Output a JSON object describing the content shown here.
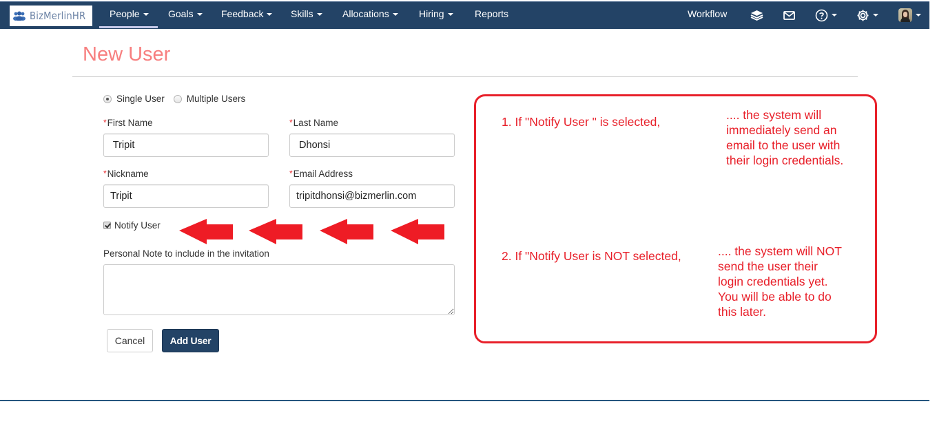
{
  "app": {
    "logo_text": "BizMerlinHR",
    "accent_color": "#234366",
    "title_color": "#f77f7f",
    "annotation_color": "#e8202a"
  },
  "navbar": {
    "items": [
      {
        "label": "People",
        "has_dropdown": true,
        "active": true
      },
      {
        "label": "Goals",
        "has_dropdown": true
      },
      {
        "label": "Feedback",
        "has_dropdown": true
      },
      {
        "label": "Skills",
        "has_dropdown": true
      },
      {
        "label": "Allocations",
        "has_dropdown": true
      },
      {
        "label": "Hiring",
        "has_dropdown": true
      },
      {
        "label": "Reports",
        "has_dropdown": false
      }
    ],
    "right": {
      "workflow_label": "Workflow",
      "icons": [
        "layers-icon",
        "mail-icon",
        "help-icon",
        "settings-icon",
        "user-avatar"
      ]
    }
  },
  "page": {
    "title": "New User",
    "mode_options": [
      {
        "label": "Single User",
        "selected": true
      },
      {
        "label": "Multiple Users",
        "selected": false
      }
    ],
    "fields": {
      "first_name": {
        "label": "First Name",
        "required": true,
        "value": " Tripit"
      },
      "last_name": {
        "label": "Last Name",
        "required": true,
        "value": " Dhonsi"
      },
      "nickname": {
        "label": "Nickname",
        "required": true,
        "value": "Tripit"
      },
      "email": {
        "label": "Email Address",
        "required": true,
        "value": "tripitdhonsi@bizmerlin.com"
      }
    },
    "notify_user": {
      "label": "Notify User",
      "checked": true
    },
    "personal_note": {
      "label": "Personal Note to include in the invitation",
      "value": ""
    },
    "buttons": {
      "cancel": "Cancel",
      "add_user": "Add User"
    }
  },
  "annotation": {
    "point1_condition": "1. If \"Notify User \" is selected,",
    "point1_result": ".... the system will\nimmediately send an\nemail to the user with\ntheir login credentials.",
    "point2_condition": "2. If \"Notify User is NOT selected,",
    "point2_result": " .... the system will NOT\nsend the user their\nlogin credentials yet.\nYou will be able to do\nthis later.",
    "arrow_count": 4
  }
}
